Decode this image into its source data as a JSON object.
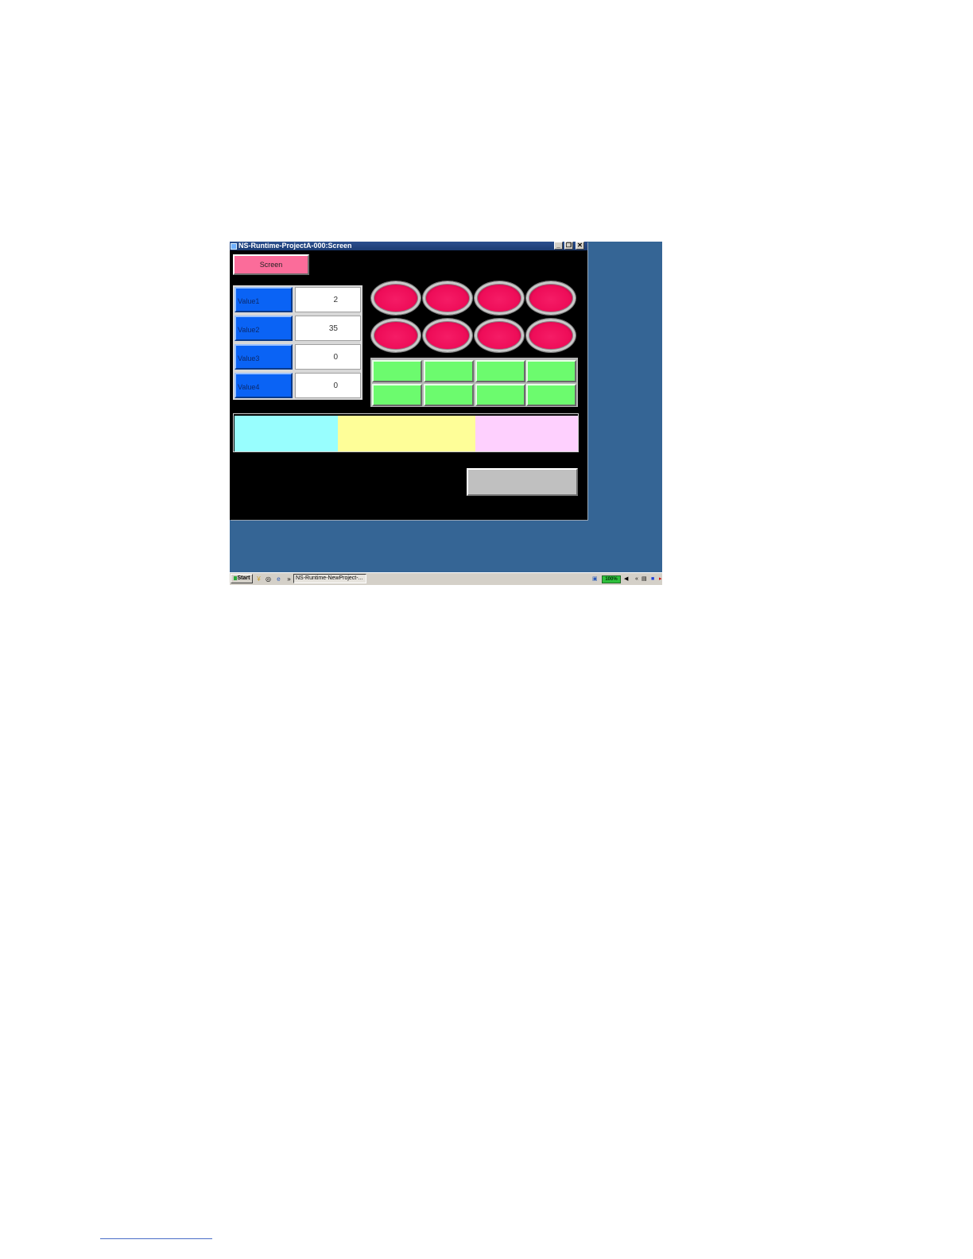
{
  "window": {
    "title": "NS-Runtime-ProjectA-000:Screen",
    "controls": {
      "minimize": "_",
      "restore": "❐",
      "close": "✕"
    }
  },
  "screen_button": {
    "label": "Screen",
    "color": "#fb6c9a"
  },
  "value_rows": [
    {
      "label": "Value1",
      "value": "2"
    },
    {
      "label": "Value2",
      "value": "35"
    },
    {
      "label": "Value3",
      "value": "0"
    },
    {
      "label": "Value4",
      "value": "0"
    }
  ],
  "lamps": {
    "count": 8,
    "color": "#ee0c58"
  },
  "green_buttons": {
    "count": 8,
    "color": "#6cfb6e"
  },
  "color_bar": [
    "#98fefe",
    "#fefe98",
    "#fed0fe"
  ],
  "gray_button": {
    "label": ""
  },
  "taskbar": {
    "start_label": "Start",
    "task_label": "NS-Runtime-NewProject-...",
    "battery": "100%",
    "quick_icons": [
      "folder-icon",
      "clock-icon",
      "ie-icon"
    ]
  },
  "colors": {
    "desktop": "#356595",
    "window_bg": "#000000",
    "value_label_bg": "#0a63f5"
  }
}
